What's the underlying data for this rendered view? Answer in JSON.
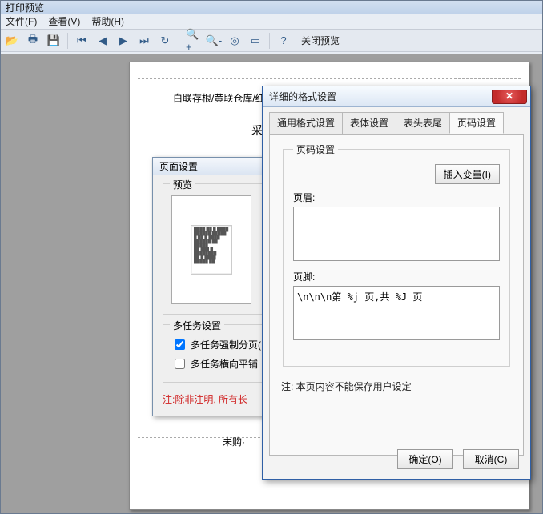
{
  "window": {
    "title": "打印预览"
  },
  "menu": {
    "file": "文件(F)",
    "view": "查看(V)",
    "help": "帮助(H)"
  },
  "toolbar": {
    "icons": {
      "open": "folder-icon",
      "print": "printer-icon",
      "save": "save-icon",
      "first": "first-page-icon",
      "prev": "prev-page-icon",
      "next": "next-page-icon",
      "last": "last-page-icon",
      "refresh": "refresh-icon",
      "zoom_in": "zoom-in-icon",
      "zoom_out": "zoom-out-icon",
      "fit": "fit-icon",
      "whole": "whole-page-icon",
      "help": "help-icon"
    },
    "close_preview": "关闭预览"
  },
  "page": {
    "header": "白联存根/黄联仓库/红",
    "subtitle": "采购类型  普",
    "purchase_line": "未购·"
  },
  "page_settings": {
    "title": "页面设置",
    "preview_group": "预览",
    "multitask_group": "多任务设置",
    "chk_force_page": "多任务强制分页(",
    "chk_tile": "多任务横向平铺",
    "note": "注:除非注明, 所有长"
  },
  "detail": {
    "title": "详细的格式设置",
    "tabs": {
      "general": "通用格式设置",
      "body": "表体设置",
      "header_footer": "表头表尾",
      "page_no": "页码设置"
    },
    "legend": "页码设置",
    "insert_var": "插入变量(I)",
    "header_label": "页眉:",
    "header_value": "",
    "footer_label": "页脚:",
    "footer_value": "\\n\\n\\n第 %j 页,共 %J 页",
    "note": "注:  本页内容不能保存用户设定",
    "ok": "确定(O)",
    "cancel": "取消(C)"
  }
}
